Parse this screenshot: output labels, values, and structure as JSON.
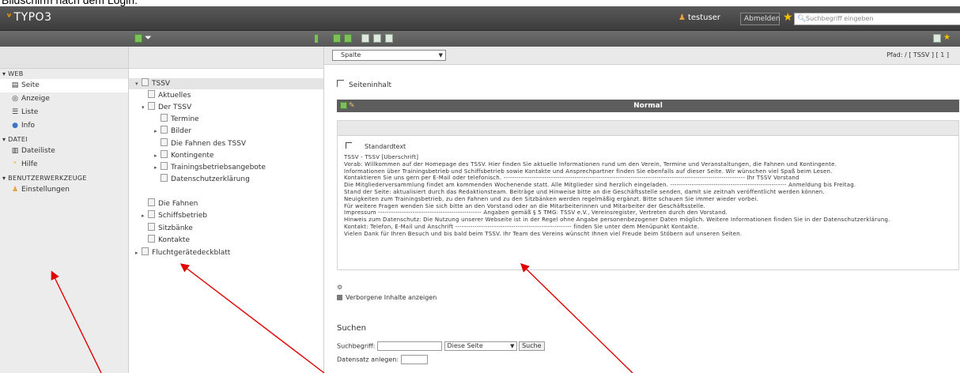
{
  "caption": "Bildschirm nach dem Login:",
  "topbar": {
    "logo": "TYPO3",
    "username": "testuser",
    "user_field": "Abmelden",
    "search_placeholder": "Suchbegriff eingeben"
  },
  "modules": {
    "groups": [
      {
        "title": "WEB",
        "items": [
          "Seite",
          "Anzeige",
          "Liste",
          "Info"
        ]
      },
      {
        "title": "DATEI",
        "items": [
          "Dateiliste",
          "Hilfe"
        ]
      },
      {
        "title": "BENUTZERWERKZEUGE",
        "items": [
          "Einstellungen"
        ]
      }
    ]
  },
  "tree": {
    "nodes": [
      "TSSV",
      "Aktuelles",
      "Der TSSV",
      "Termine",
      "Bilder",
      "Die Fahnen des TSSV",
      "Kontingente",
      "Trainingsbetriebsangebote",
      "Datenschutzerklärung",
      "Die Fahnen",
      "Schiffsbetrieb",
      "Sitzbänke",
      "Kontakte",
      "Fluchtgerätedeckblatt"
    ]
  },
  "content": {
    "doc_select": "Spalte",
    "path": "Pfad: / [ TSSV ] [ 1 ]",
    "section": "Seiteninhalt",
    "column_header": "Normal",
    "ce_title": "Standardtext",
    "ce_lines": [
      "TSSV - TSSV [Überschrift]",
      "Vorab: Willkommen auf der Homepage des TSSV. Hier finden Sie aktuelle Informationen rund um den Verein, Termine und Veranstaltungen, die Fahnen und Kontingente.",
      "Informationen über Trainingsbetrieb und Schiffsbetrieb sowie Kontakte und Ansprechpartner finden Sie ebenfalls auf dieser Seite. Wir wünschen viel Spaß beim Lesen.",
      "Kontaktieren Sie uns gern per E-Mail oder telefonisch. ---------------------------------------------------------------------------------------------------------------- Ihr TSSV Vorstand",
      "Die Mitgliederversammlung findet am kommenden Wochenende statt. Alle Mitglieder sind herzlich eingeladen. ------------------------------------------------------ Anmeldung bis Freitag.",
      "Stand der Seite: aktualisiert durch das Redaktionsteam. Beiträge und Hinweise bitte an die Geschäftsstelle senden, damit sie zeitnah veröffentlicht werden können.",
      "Neuigkeiten zum Trainingsbetrieb, zu den Fahnen und zu den Sitzbänken werden regelmäßig ergänzt. Bitte schauen Sie immer wieder vorbei.",
      "Für weitere Fragen wenden Sie sich bitte an den Vorstand oder an die Mitarbeiterinnen und Mitarbeiter der Geschäftsstelle.",
      "Impressum ------------------------------------------------ Angaben gemäß § 5 TMG: TSSV e.V., Vereinsregister, Vertreten durch den Vorstand.",
      "Hinweis zum Datenschutz: Die Nutzung unserer Webseite ist in der Regel ohne Angabe personenbezogener Daten möglich. Weitere Informationen finden Sie in der Datenschutzerklärung.",
      "Kontakt: Telefon, E-Mail und Anschrift ------------------------------------------------------ finden Sie unter dem Menüpunkt Kontakte.",
      "Vielen Dank für Ihren Besuch und bis bald beim TSSV. Ihr Team des Vereins wünscht Ihnen viel Freude beim Stöbern auf unseren Seiten."
    ],
    "hidden_label": "Verborgene Inhalte anzeigen",
    "search_header": "Suchen",
    "search_label": "Suchbegriff:",
    "search_select": "Diese Seite",
    "search_button": "Suche",
    "date_label": "Datensatz anlegen:"
  }
}
